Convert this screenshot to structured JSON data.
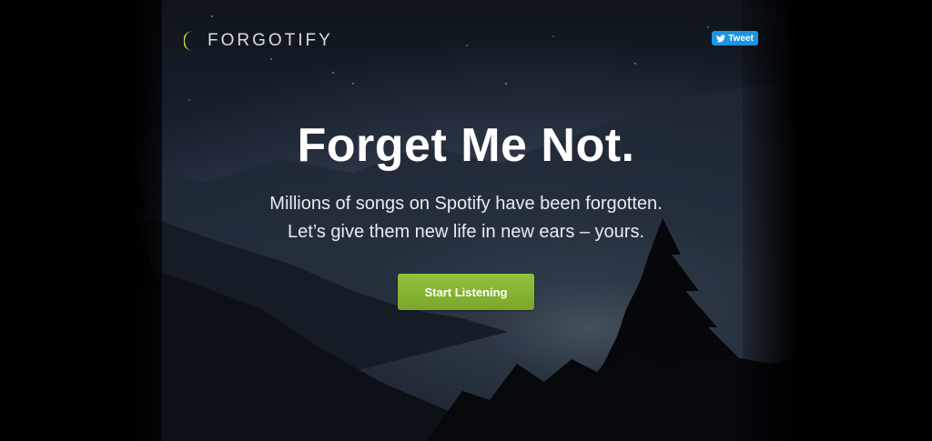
{
  "brand": {
    "name": "FORGOTIFY",
    "accent_color": "#c4dd2f"
  },
  "tweet_button": {
    "label": "Tweet",
    "icon": "twitter-bird-icon",
    "color": "#1b95e0"
  },
  "hero": {
    "headline": "Forget Me Not.",
    "subline_1": "Millions of songs on Spotify have been forgotten.",
    "subline_2": "Let’s give them new life in new ears – yours.",
    "cta_label": "Start Listening",
    "cta_color": "#86b534"
  }
}
